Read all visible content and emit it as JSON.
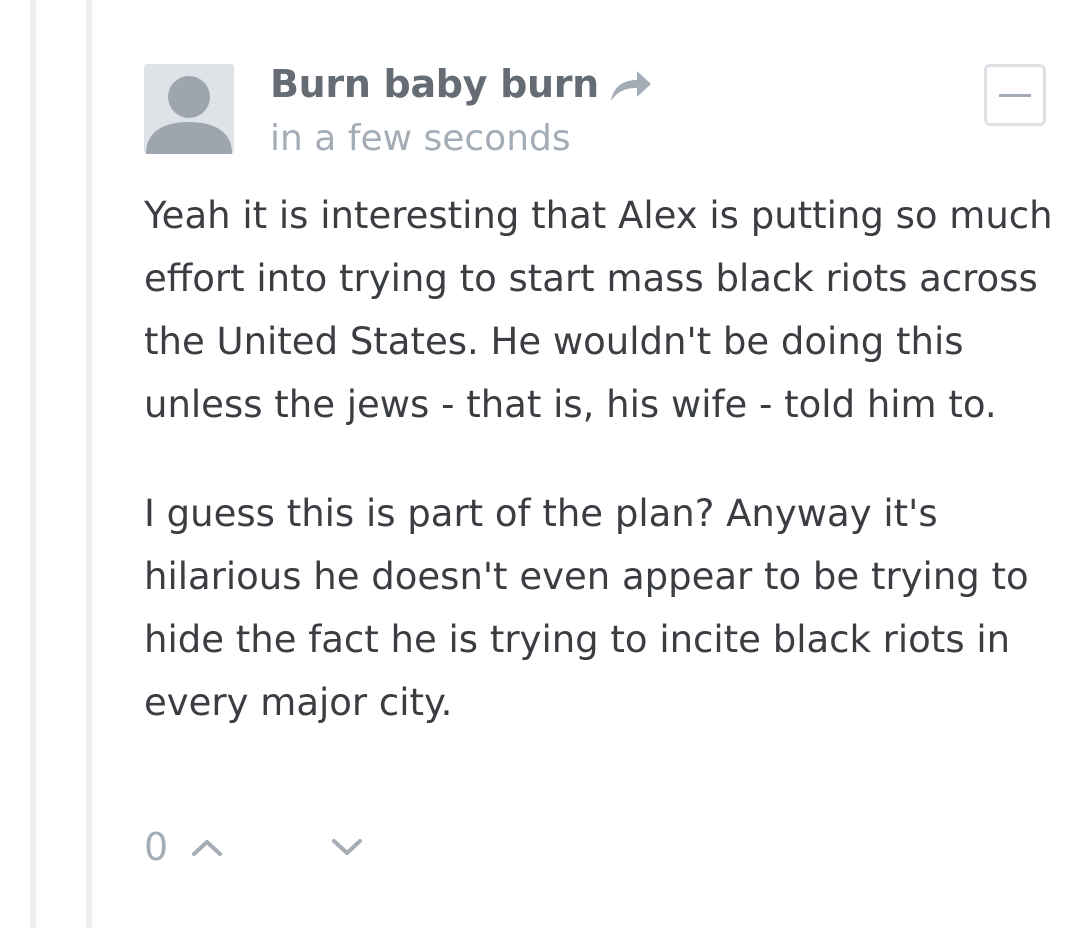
{
  "comment": {
    "author": "Burn baby burn",
    "timestamp": "in a few seconds",
    "icons": {
      "avatar": "default-user-avatar-icon",
      "reply": "reply-arrow-icon",
      "collapse": "minus-icon",
      "upvote": "chevron-up-icon",
      "downvote": "chevron-down-icon"
    },
    "paragraphs": [
      "Yeah it is interesting that Alex is putting so much effort into trying to start mass black riots across the United States. He wouldn't be doing this unless the jews - that is, his wife - told him to.",
      "I guess this is part of the plan? Anyway it's hilarious he doesn't even appear to be trying to hide the fact he is trying to incite black riots in every major city."
    ],
    "vote_count": "0"
  },
  "colors": {
    "author": "#656c74",
    "muted": "#a4adb6",
    "body_text": "#3a3d42",
    "thread_line": "#eceef0",
    "avatar_bg": "#dfe3e7",
    "avatar_figure": "#9da6af"
  }
}
